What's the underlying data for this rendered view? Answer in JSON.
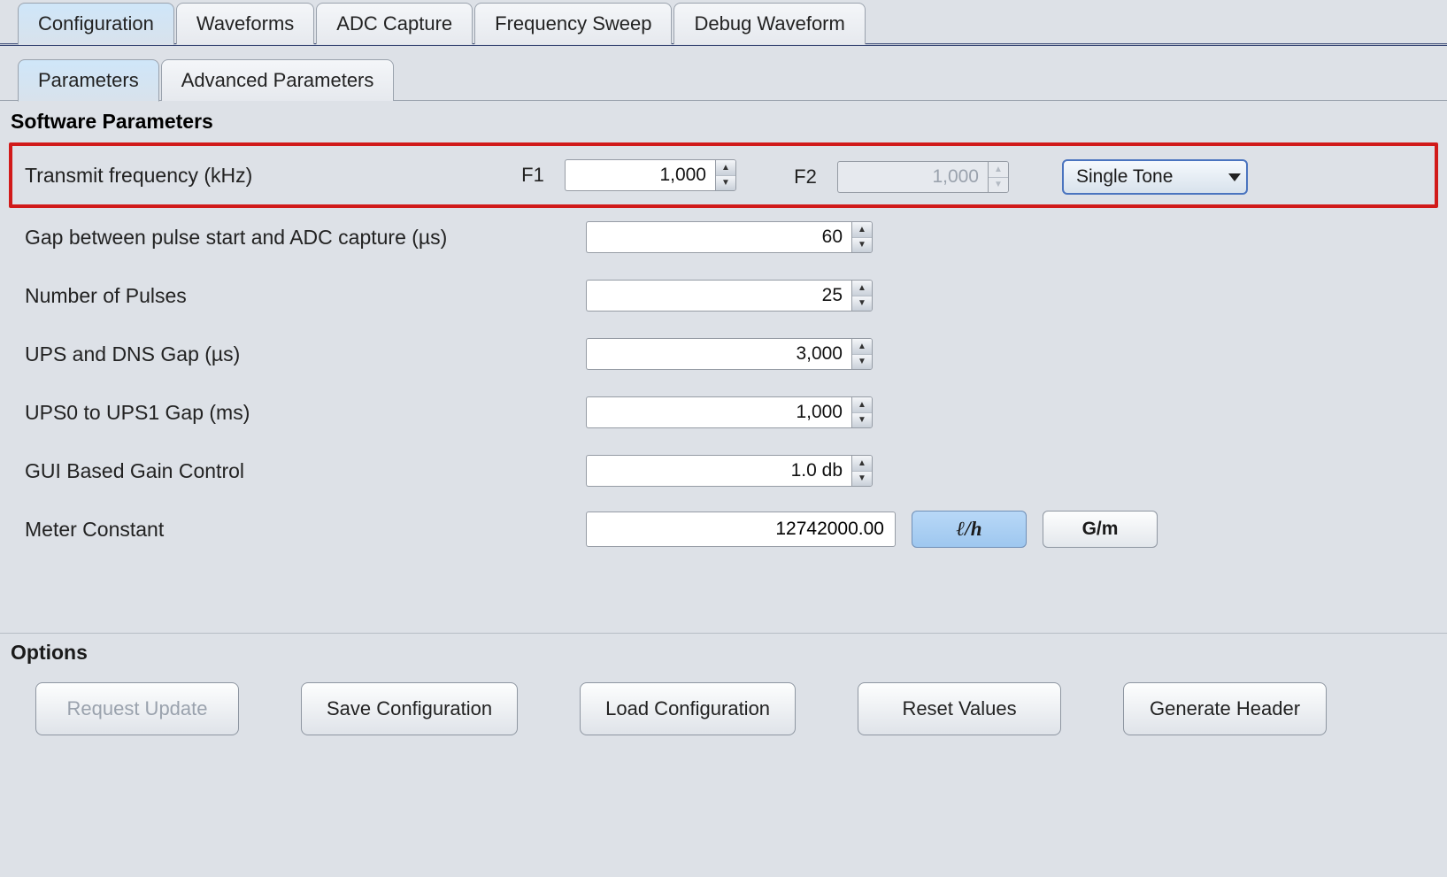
{
  "tabs": {
    "outer": [
      "Configuration",
      "Waveforms",
      "ADC Capture",
      "Frequency Sweep",
      "Debug Waveform"
    ],
    "outer_active": 0,
    "inner": [
      "Parameters",
      "Advanced Parameters"
    ],
    "inner_active": 0
  },
  "sections": {
    "software_parameters": "Software Parameters",
    "options": "Options"
  },
  "params": {
    "transmit_freq": {
      "label": "Transmit frequency (kHz)",
      "f1_label": "F1",
      "f1_value": "1,000",
      "f2_label": "F2",
      "f2_value": "1,000",
      "mode_selected": "Single Tone"
    },
    "gap_pulse_adc": {
      "label": "Gap between pulse start and ADC capture (µs)",
      "value": "60"
    },
    "num_pulses": {
      "label": "Number of Pulses",
      "value": "25"
    },
    "ups_dns_gap": {
      "label": "UPS and DNS Gap (µs)",
      "value": "3,000"
    },
    "ups0_ups1_gap": {
      "label": "UPS0 to UPS1 Gap (ms)",
      "value": "1,000"
    },
    "gain_control": {
      "label": "GUI Based Gain Control",
      "value": "1.0 db"
    },
    "meter_constant": {
      "label": "Meter Constant",
      "value": "12742000.00",
      "unit_lph": "ℓ/h",
      "unit_gpm": "G/m",
      "unit_active": "lph"
    }
  },
  "options": {
    "request_update": "Request Update",
    "save_config": "Save Configuration",
    "load_config": "Load Configuration",
    "reset_values": "Reset Values",
    "generate_header": "Generate Header"
  }
}
